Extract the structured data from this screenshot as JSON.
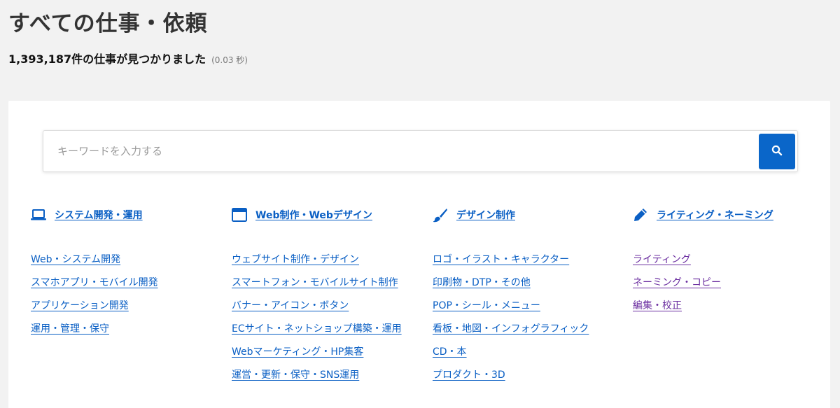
{
  "page": {
    "title": "すべての仕事・依頼",
    "result_count_text": "1,393,187件の仕事が見つかりました",
    "time_text": "(0.03 秒)"
  },
  "search": {
    "placeholder": "キーワードを入力する",
    "value": "",
    "button_icon": "search-icon"
  },
  "colors": {
    "link": "#0a5fc4",
    "visited_link": "#6b2ea0",
    "search_button": "#0a66c9",
    "page_background": "#f2f2f2"
  },
  "categories": [
    {
      "icon": "laptop-icon",
      "title": "システム開発・運用",
      "links": [
        "Web・システム開発",
        "スマホアプリ・モバイル開発",
        "アプリケーション開発",
        "運用・管理・保守"
      ]
    },
    {
      "icon": "browser-window-icon",
      "title": "Web制作・Webデザイン",
      "links": [
        "ウェブサイト制作・デザイン",
        "スマートフォン・モバイルサイト制作",
        "バナー・アイコン・ボタン",
        "ECサイト・ネットショップ構築・運用",
        "Webマーケティング・HP集客",
        "運営・更新・保守・SNS運用"
      ]
    },
    {
      "icon": "paintbrush-icon",
      "title": "デザイン制作",
      "links": [
        "ロゴ・イラスト・キャラクター",
        "印刷物・DTP・その他",
        "POP・シール・メニュー",
        "看板・地図・インフォグラフィック",
        "CD・本",
        "プロダクト・3D"
      ]
    },
    {
      "icon": "pencil-icon",
      "title": "ライティング・ネーミング",
      "links": [
        "ライティング",
        "ネーミング・コピー",
        "編集・校正"
      ]
    }
  ]
}
